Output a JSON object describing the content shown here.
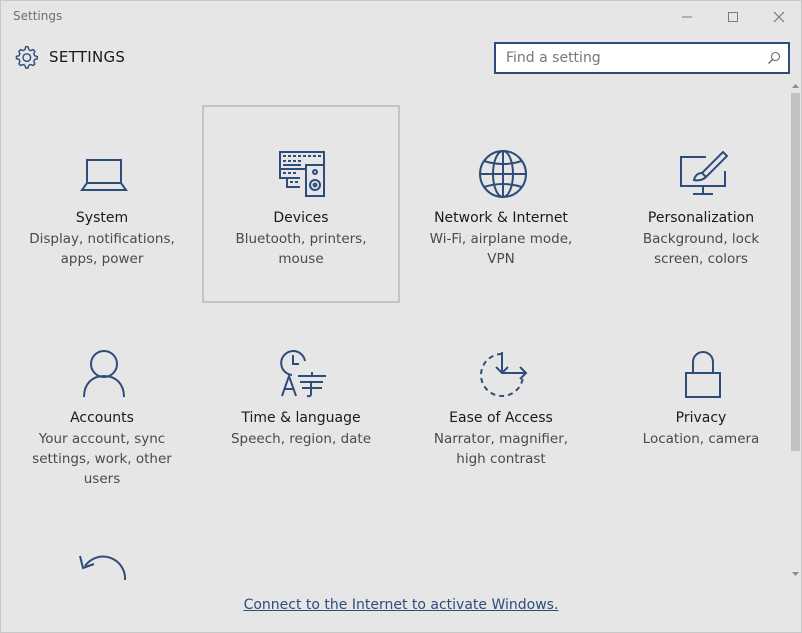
{
  "window": {
    "title": "Settings",
    "minimize_icon": "minimize-icon",
    "maximize_icon": "maximize-icon",
    "close_icon": "close-icon"
  },
  "header": {
    "title": "SETTINGS",
    "icon": "gear-icon"
  },
  "search": {
    "placeholder": "Find a setting",
    "value": "",
    "icon": "search-icon"
  },
  "categories": [
    {
      "id": "system",
      "name": "System",
      "description": "Display, notifications, apps, power",
      "icon": "laptop-icon"
    },
    {
      "id": "devices",
      "name": "Devices",
      "description": "Bluetooth, printers, mouse",
      "icon": "keyboard-speaker-icon"
    },
    {
      "id": "network",
      "name": "Network & Internet",
      "description": "Wi-Fi, airplane mode, VPN",
      "icon": "globe-icon"
    },
    {
      "id": "personalization",
      "name": "Personalization",
      "description": "Background, lock screen, colors",
      "icon": "monitor-brush-icon"
    },
    {
      "id": "accounts",
      "name": "Accounts",
      "description": "Your account, sync settings, work, other users",
      "icon": "person-icon"
    },
    {
      "id": "time",
      "name": "Time & language",
      "description": "Speech, region, date",
      "icon": "clock-language-icon"
    },
    {
      "id": "ease",
      "name": "Ease of Access",
      "description": "Narrator, magnifier, high contrast",
      "icon": "ease-of-access-icon"
    },
    {
      "id": "privacy",
      "name": "Privacy",
      "description": "Location, camera",
      "icon": "padlock-icon"
    }
  ],
  "partial_tile_icon": "update-arrow-icon",
  "footer": {
    "activate_link": "Connect to the Internet to activate Windows."
  },
  "colors": {
    "accent": "#2e4d7a",
    "background": "#e6e6e6"
  }
}
